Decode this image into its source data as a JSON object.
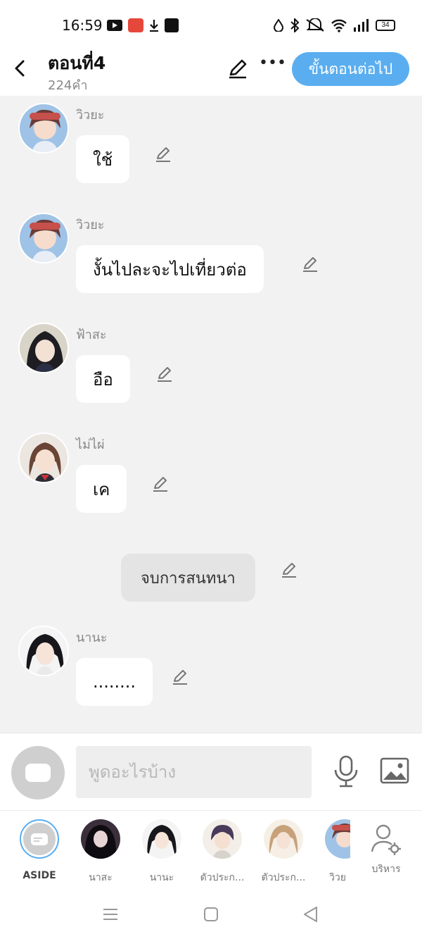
{
  "status_bar": {
    "time": "16:59",
    "battery": "34"
  },
  "header": {
    "title": "ตอนที่4",
    "word_count": "224คำ",
    "next_label": "ขั้นตอนต่อไป"
  },
  "messages": [
    {
      "speaker": "วิวยะ",
      "text": "ใช้"
    },
    {
      "speaker": "วิวยะ",
      "text": "งั้นไปละจะไปเที่ยวต่อ"
    },
    {
      "speaker": "ฟ้าสะ",
      "text": "อือ"
    },
    {
      "speaker": "ไม่ไผ่",
      "text": "เค"
    },
    {
      "speaker": "",
      "text": "จบการสนทนา"
    },
    {
      "speaker": "นานะ",
      "text": "........"
    }
  ],
  "input": {
    "placeholder": "พูดอะไรบ้าง"
  },
  "characters": [
    {
      "label": "ASIDE"
    },
    {
      "label": "นาสะ"
    },
    {
      "label": "นานะ"
    },
    {
      "label": "ตัวประก..."
    },
    {
      "label": "ตัวประก..."
    },
    {
      "label": "วิวย"
    },
    {
      "label": "บริหาร"
    }
  ],
  "colors": {
    "accent": "#5aaef0",
    "background": "#f2f2f2"
  }
}
